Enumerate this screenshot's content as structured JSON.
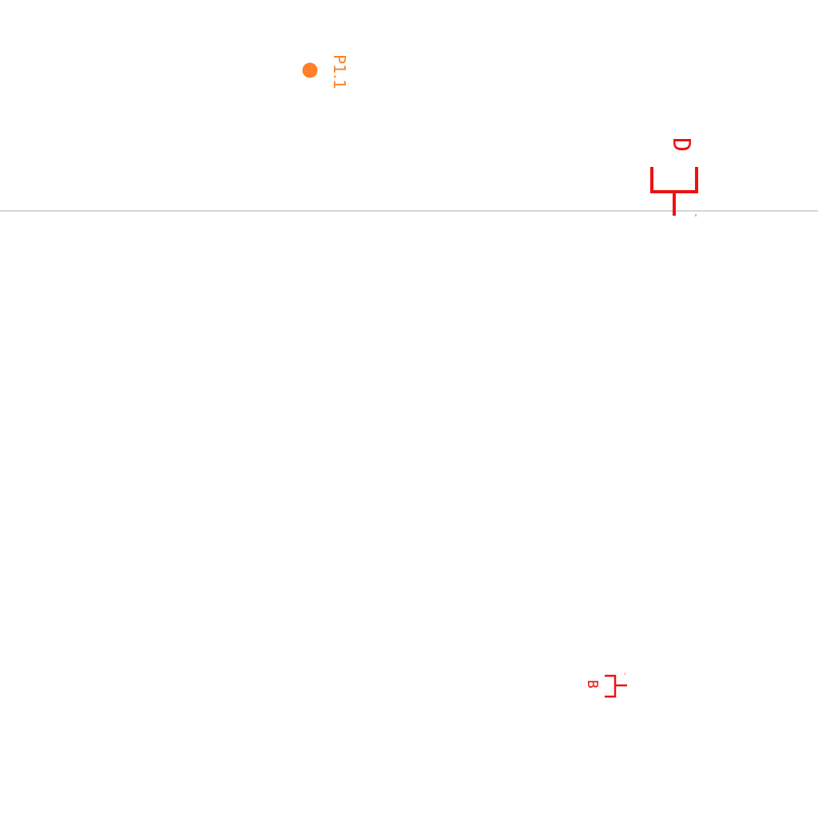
{
  "pin": {
    "label": "P1.1",
    "color": "#ff7f2a"
  },
  "symbol_top": {
    "label": "D",
    "color": "#ee1111"
  },
  "symbol_bottom": {
    "label": "B",
    "color": "#ee1111"
  },
  "divider": {
    "color": "#c8c8c8"
  }
}
